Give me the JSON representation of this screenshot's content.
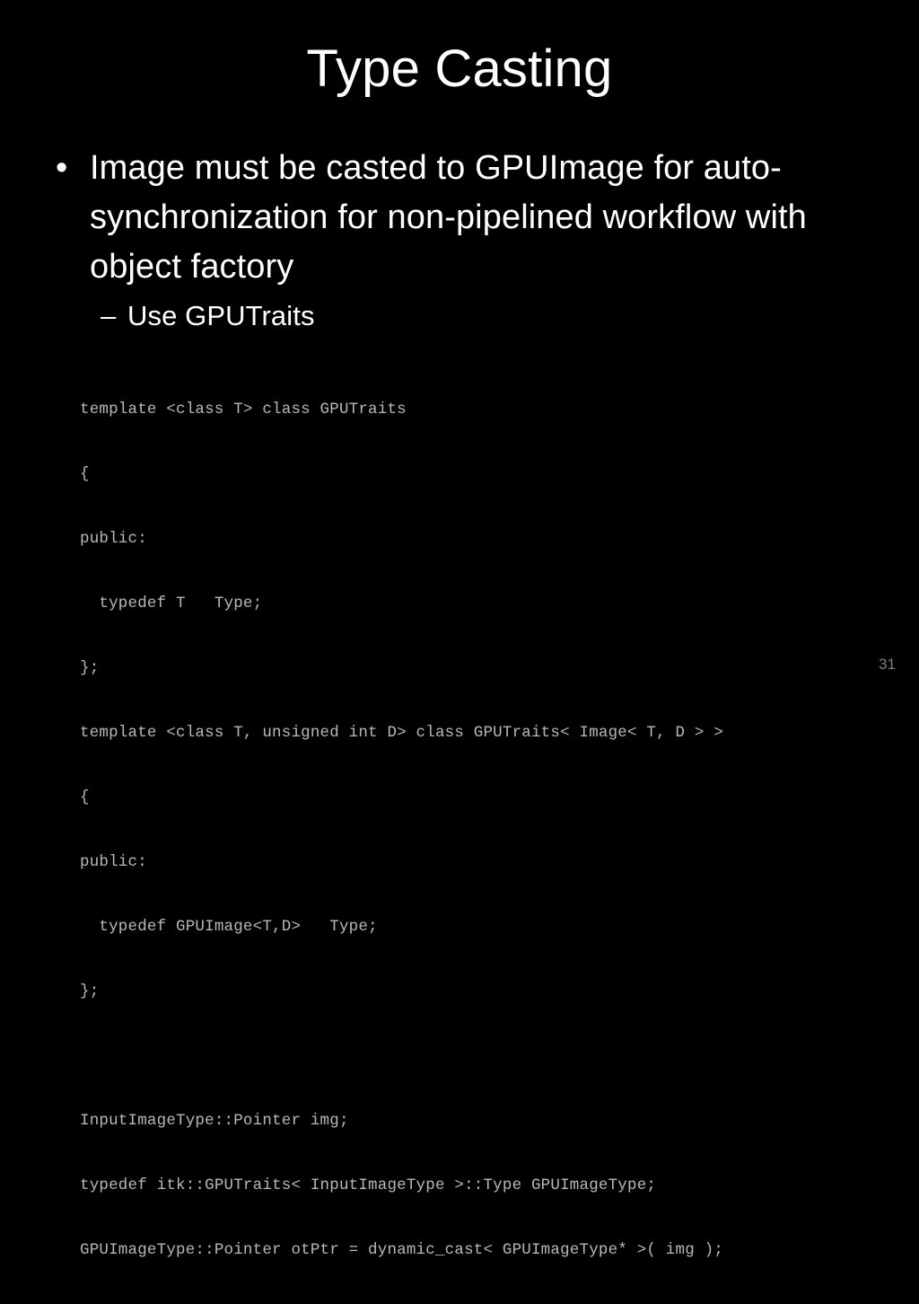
{
  "slide": {
    "title": "Type Casting",
    "background_color": "#000000",
    "text_color": "#ffffff",
    "code_color": "#b8b8b8",
    "slide_number": "31",
    "bullets": [
      {
        "marker": "•",
        "text": "Image must be casted to GPUImage for auto-synchronization for non-pipelined workflow with object factory"
      }
    ],
    "subbullets": [
      {
        "marker": "–",
        "text": "Use GPUTraits"
      }
    ],
    "code_lines": [
      "template <class T> class GPUTraits",
      "{",
      "public:",
      "  typedef T   Type;",
      "};",
      "template <class T, unsigned int D> class GPUTraits< Image< T, D > >",
      "{",
      "public:",
      "  typedef GPUImage<T,D>   Type;",
      "};",
      "",
      "InputImageType::Pointer img;",
      "typedef itk::GPUTraits< InputImageType >::Type GPUImageType;",
      "GPUImageType::Pointer otPtr = dynamic_cast< GPUImageType* >( img );"
    ]
  }
}
